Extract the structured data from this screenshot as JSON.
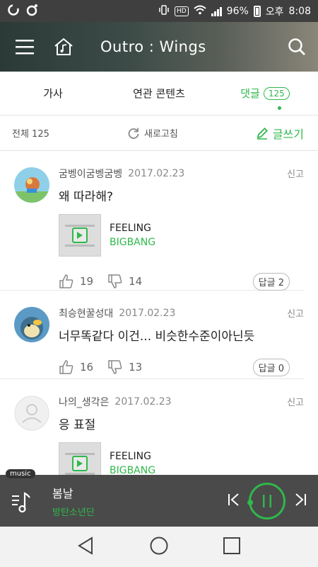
{
  "status_bar": {
    "battery": "96%",
    "ampm": "오후",
    "time": "8:08",
    "hd": "HD"
  },
  "header": {
    "title": "Outro : Wings"
  },
  "tabs": [
    {
      "label": "가사"
    },
    {
      "label": "연관 콘텐츠"
    },
    {
      "label": "댓글",
      "count": "125",
      "active": true
    }
  ],
  "toolbar": {
    "total": "전체 125",
    "refresh": "새로고침",
    "write": "글쓰기"
  },
  "comments": [
    {
      "author": "굼벵이굼벵굼벵",
      "date": "2017.02.23",
      "report": "신고",
      "text": "왜 따라해?",
      "song": {
        "title": "FEELING",
        "artist": "BIGBANG"
      },
      "likes": "19",
      "dislikes": "14",
      "reply": "답글 2"
    },
    {
      "author": "최승현꿀성대",
      "date": "2017.02.23",
      "report": "신고",
      "text": "너무똑같다 이건... 비슷한수준이아닌듯",
      "likes": "16",
      "dislikes": "13",
      "reply": "답글 0"
    },
    {
      "author": "나의_생각은",
      "date": "2017.02.23",
      "report": "신고",
      "text": "응 표절",
      "song": {
        "title": "FEELING",
        "artist": "BIGBANG"
      }
    }
  ],
  "player": {
    "tag": "music",
    "title": "봄날",
    "artist": "방탄소년단"
  },
  "colors": {
    "accent": "#2fb84b",
    "player_bg": "#4a4a4a",
    "status_bg": "#3f3f3f"
  }
}
